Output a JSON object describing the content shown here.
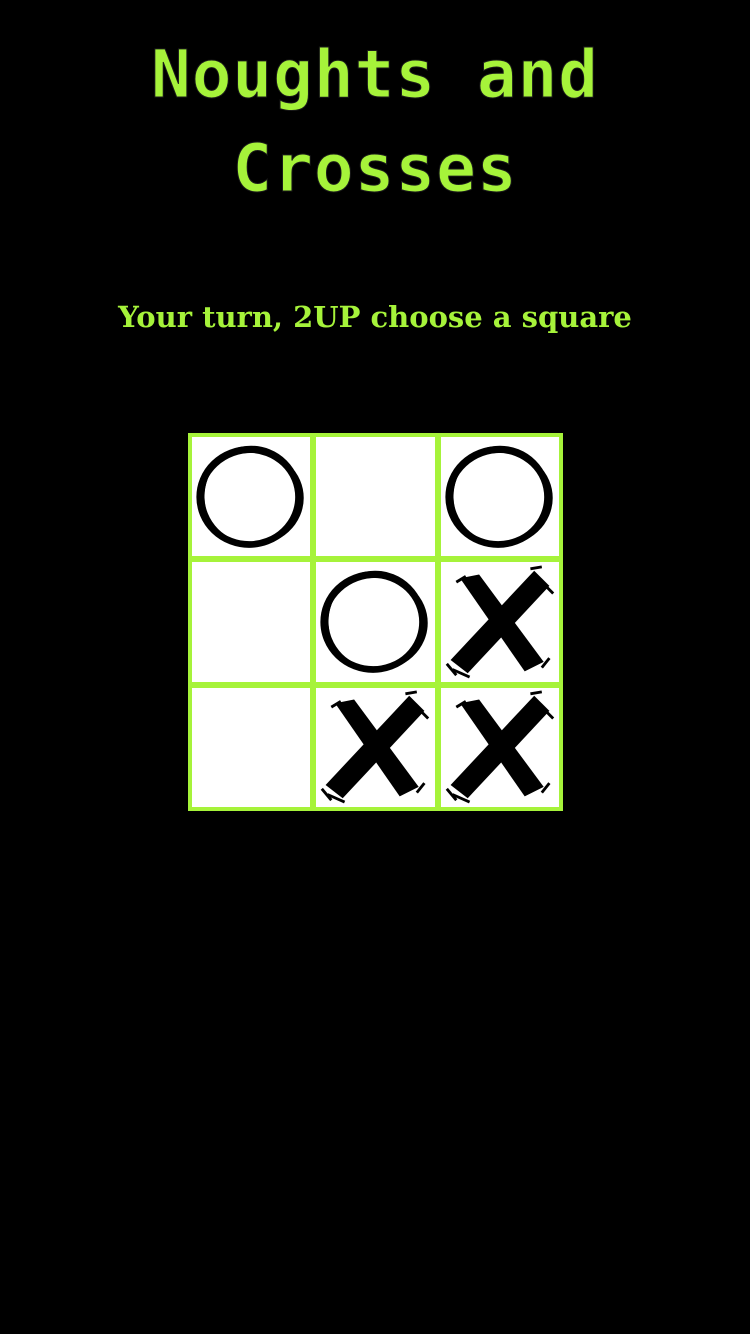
{
  "title": {
    "line1": "Noughts and",
    "line2": "Crosses"
  },
  "status_text": "Your turn, 2UP choose a square",
  "colors": {
    "background": "#000000",
    "accent": "#a6f33a",
    "cell": "#ffffff",
    "mark": "#000000"
  },
  "board": {
    "cells": [
      {
        "mark": "O",
        "icon": "nought-icon"
      },
      {
        "mark": "",
        "icon": ""
      },
      {
        "mark": "O",
        "icon": "nought-icon"
      },
      {
        "mark": "",
        "icon": ""
      },
      {
        "mark": "O",
        "icon": "nought-icon"
      },
      {
        "mark": "X",
        "icon": "cross-icon"
      },
      {
        "mark": "",
        "icon": ""
      },
      {
        "mark": "X",
        "icon": "cross-icon"
      },
      {
        "mark": "X",
        "icon": "cross-icon"
      }
    ]
  }
}
